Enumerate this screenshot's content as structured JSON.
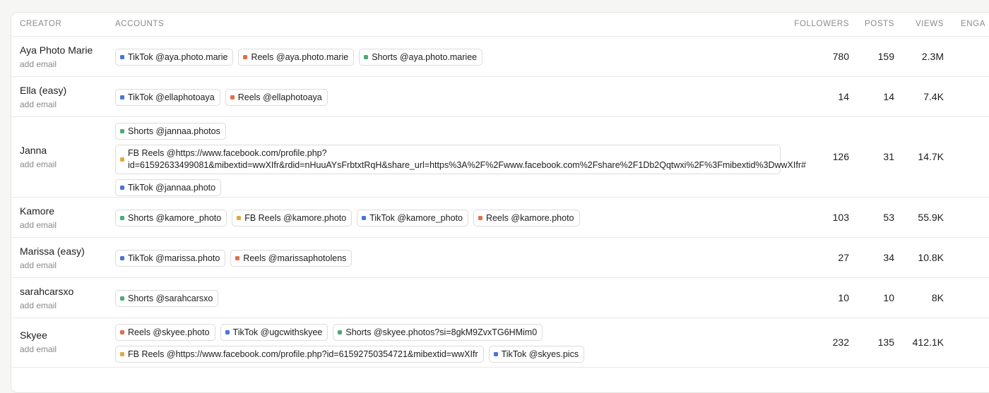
{
  "colors": {
    "tiktok": "#4a74d6",
    "reels": "#e0704a",
    "shorts": "#4daa75",
    "fbreels": "#e5a83a"
  },
  "columns": {
    "creator": "CREATOR",
    "accounts": "ACCOUNTS",
    "followers": "FOLLOWERS",
    "posts": "POSTS",
    "views": "VIEWS",
    "engagement": "ENGA"
  },
  "rows": [
    {
      "name": "Aya Photo Marie",
      "email": "add email",
      "accounts": [
        {
          "platform": "tiktok",
          "label": "TikTok @aya.photo.marie"
        },
        {
          "platform": "reels",
          "label": "Reels @aya.photo.marie"
        },
        {
          "platform": "shorts",
          "label": "Shorts @aya.photo.mariee"
        }
      ],
      "followers": "780",
      "posts": "159",
      "views": "2.3M"
    },
    {
      "name": "Ella (easy)",
      "email": "add email",
      "accounts": [
        {
          "platform": "tiktok",
          "label": "TikTok @ellaphotoaya"
        },
        {
          "platform": "reels",
          "label": "Reels @ellaphotoaya"
        }
      ],
      "followers": "14",
      "posts": "14",
      "views": "7.4K"
    },
    {
      "name": "Janna",
      "email": "add email",
      "accounts": [
        {
          "platform": "shorts",
          "label": "Shorts @jannaa.photos"
        },
        {
          "platform": "fbreels",
          "label": "FB Reels @https://www.facebook.com/profile.php?id=61592633499081&mibextid=wwXIfr&rdid=nHuuAYsFrbtxtRqH&share_url=https%3A%2F%2Fwww.facebook.com%2Fshare%2F1Db2Qqtwxi%2F%3Fmibextid%3DwwXIfr#"
        },
        {
          "platform": "tiktok",
          "label": "TikTok @jannaa.photo"
        }
      ],
      "followers": "126",
      "posts": "31",
      "views": "14.7K"
    },
    {
      "name": "Kamore",
      "email": "add email",
      "accounts": [
        {
          "platform": "shorts",
          "label": "Shorts @kamore_photo"
        },
        {
          "platform": "fbreels",
          "label": "FB Reels @kamore.photo"
        },
        {
          "platform": "tiktok",
          "label": "TikTok @kamore_photo"
        },
        {
          "platform": "reels",
          "label": "Reels @kamore.photo"
        }
      ],
      "followers": "103",
      "posts": "53",
      "views": "55.9K"
    },
    {
      "name": "Marissa (easy)",
      "email": "add email",
      "accounts": [
        {
          "platform": "tiktok",
          "label": "TikTok @marissa.photo"
        },
        {
          "platform": "reels",
          "label": "Reels @marissaphotolens"
        }
      ],
      "followers": "27",
      "posts": "34",
      "views": "10.8K"
    },
    {
      "name": "sarahcarsxo",
      "email": "add email",
      "accounts": [
        {
          "platform": "shorts",
          "label": "Shorts @sarahcarsxo"
        }
      ],
      "followers": "10",
      "posts": "10",
      "views": "8K"
    },
    {
      "name": "Skyee",
      "email": "add email",
      "accounts": [
        {
          "platform": "reels",
          "label": "Reels @skyee.photo"
        },
        {
          "platform": "tiktok",
          "label": "TikTok @ugcwithskyee"
        },
        {
          "platform": "shorts",
          "label": "Shorts @skyee.photos?si=8gkM9ZvxTG6HMim0"
        },
        {
          "platform": "fbreels",
          "label": "FB Reels @https://www.facebook.com/profile.php?id=61592750354721&mibextid=wwXIfr"
        },
        {
          "platform": "tiktok",
          "label": "TikTok @skyes.pics"
        }
      ],
      "followers": "232",
      "posts": "135",
      "views": "412.1K"
    }
  ]
}
